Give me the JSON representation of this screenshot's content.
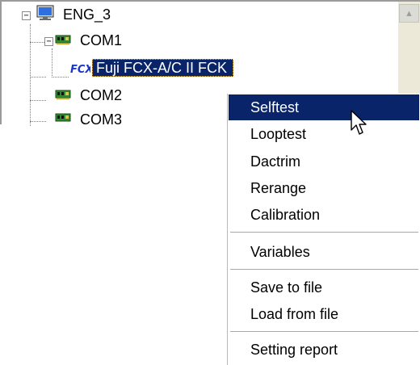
{
  "tree": {
    "root_label": "ENG_3",
    "items": [
      {
        "label": "COM1"
      },
      {
        "label": "Fuji FCX-A/C II FCK"
      },
      {
        "label": "COM2"
      },
      {
        "label": "COM3"
      }
    ],
    "expander_minus": "−"
  },
  "scrollbar": {
    "up_arrow": "▲"
  },
  "context_menu": {
    "items": [
      "Selftest",
      "Looptest",
      "Dactrim",
      "Rerange",
      "Calibration",
      "Variables",
      "Save to file",
      "Load from file",
      "Setting report"
    ],
    "highlight": "Selftest"
  },
  "icons": {
    "root": "computer-monitor-icon",
    "port": "com-port-chip-icon",
    "device": "fcx-device-icon",
    "pointer": "mouse-cursor-icon"
  },
  "colors": {
    "selection": "#0a246a",
    "chip_green": "#2e8b2e",
    "fcx_blue": "#1a37c7"
  }
}
